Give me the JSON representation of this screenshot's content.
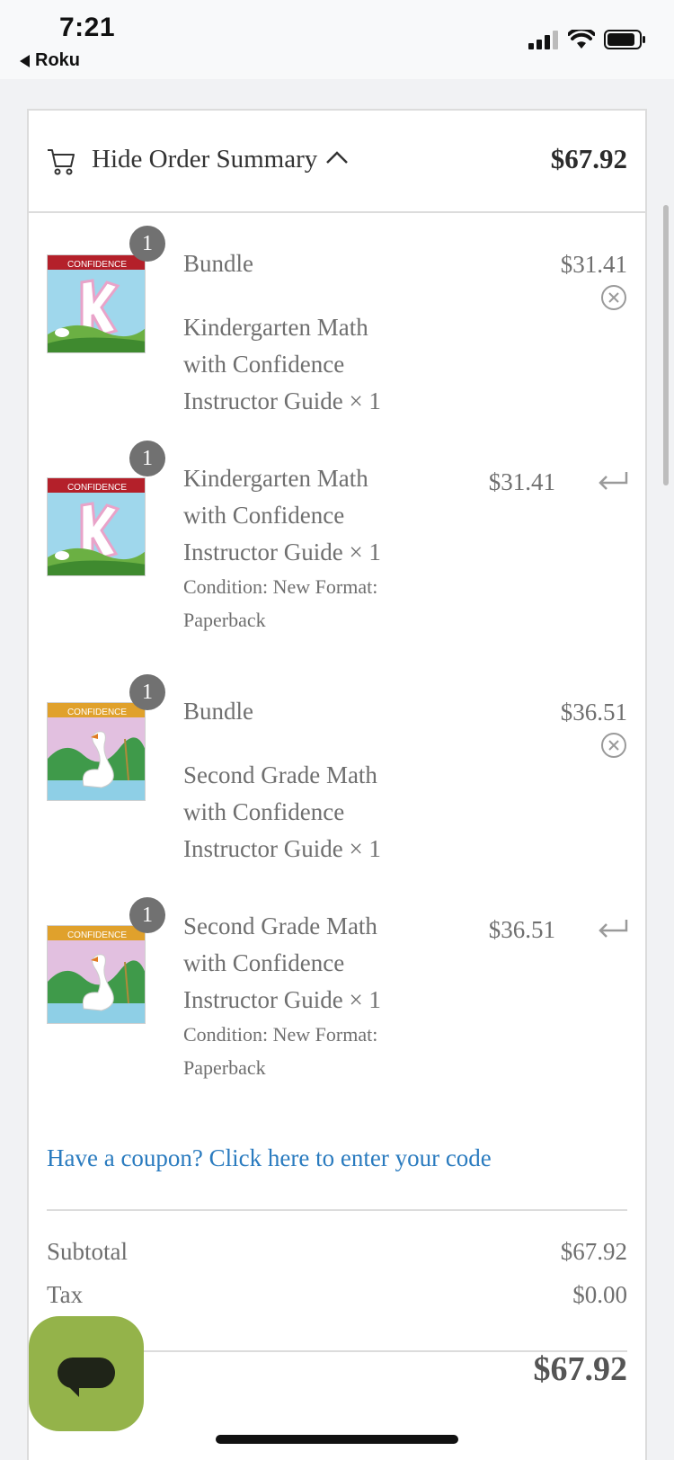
{
  "status_bar": {
    "time": "7:21",
    "back_app": "Roku",
    "icons": [
      "cellular-signal-icon",
      "wifi-icon",
      "battery-icon"
    ]
  },
  "summary": {
    "toggle_label": "Hide Order Summary",
    "header_total": "$67.92"
  },
  "items": [
    {
      "title": "Bundle",
      "lines": [
        "Kindergarten Math",
        "with Confidence",
        "Instructor Guide × 1"
      ],
      "price": "$31.41",
      "qty": "1",
      "action_icon": "remove-icon"
    },
    {
      "lines": [
        "Kindergarten Math",
        "with Confidence",
        "Instructor Guide × 1"
      ],
      "condition": [
        "Condition: New Format:",
        "Paperback"
      ],
      "price": "$31.41",
      "qty": "1",
      "action_icon": "return-icon"
    },
    {
      "title": "Bundle",
      "lines": [
        "Second Grade Math",
        "with Confidence",
        "Instructor Guide × 1"
      ],
      "price": "$36.51",
      "qty": "1",
      "action_icon": "remove-icon"
    },
    {
      "lines": [
        "Second Grade Math",
        "with Confidence",
        "Instructor Guide × 1"
      ],
      "condition": [
        "Condition: New Format:",
        "Paperback"
      ],
      "price": "$36.51",
      "qty": "1",
      "action_icon": "return-icon"
    }
  ],
  "coupon": {
    "link_text": "Have a coupon? Click here to enter your code"
  },
  "totals": {
    "subtotal_label": "Subtotal",
    "subtotal_value": "$67.92",
    "tax_label": "Tax",
    "tax_value": "$0.00",
    "total_value": "$67.92"
  },
  "colors": {
    "link": "#2a7bbf",
    "chat_fab": "#94b34a",
    "badge": "#717171"
  }
}
